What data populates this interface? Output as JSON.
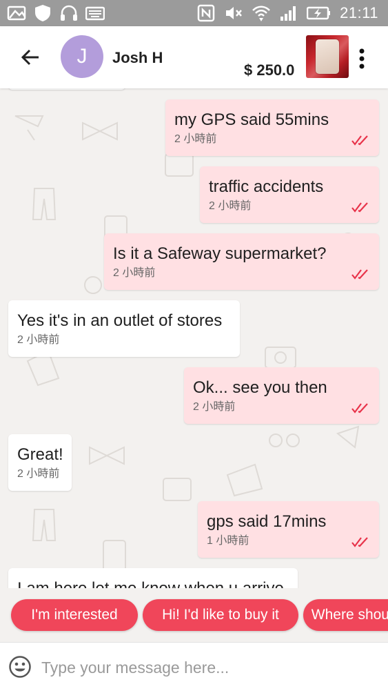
{
  "status_bar": {
    "time": "21:11",
    "icons": [
      "image-icon",
      "shield-icon",
      "headphones-icon",
      "keyboard-icon",
      "nfc-icon",
      "mute-icon",
      "wifi-icon",
      "signal-icon",
      "battery-charging-icon"
    ]
  },
  "header": {
    "avatar_initial": "J",
    "contact_name": "Josh H",
    "price": "$ 250.0",
    "colors": {
      "avatar": "#b39ddb"
    }
  },
  "messages": [
    {
      "direction": "in",
      "text": "",
      "time": ""
    },
    {
      "direction": "out",
      "text": "my GPS said 55mins",
      "time": "2 小時前",
      "status": "read"
    },
    {
      "direction": "out",
      "text": "traffic accidents",
      "time": "2 小時前",
      "status": "read"
    },
    {
      "direction": "out",
      "text": "Is it a Safeway supermarket?",
      "time": "2 小時前",
      "status": "read"
    },
    {
      "direction": "in",
      "text": "Yes it's in an outlet of stores",
      "time": "2 小時前"
    },
    {
      "direction": "out",
      "text": "Ok...  see you then",
      "time": "2 小時前",
      "status": "read"
    },
    {
      "direction": "in",
      "text": "Great!",
      "time": "2 小時前"
    },
    {
      "direction": "out",
      "text": "gps said 17mins",
      "time": "1 小時前",
      "status": "read"
    },
    {
      "direction": "in",
      "text": "I am here let me know when u arrive",
      "time": ""
    }
  ],
  "quick_replies": [
    "I'm interested",
    "Hi! I'd like to buy it",
    "Where should we meet?"
  ],
  "input": {
    "placeholder": "Type your message here..."
  },
  "colors": {
    "outgoing_bubble": "#ffe0e3",
    "incoming_bubble": "#ffffff",
    "accent": "#f0465a",
    "read_ticks": "#e8334a",
    "status_bar": "#9b9b9b"
  }
}
